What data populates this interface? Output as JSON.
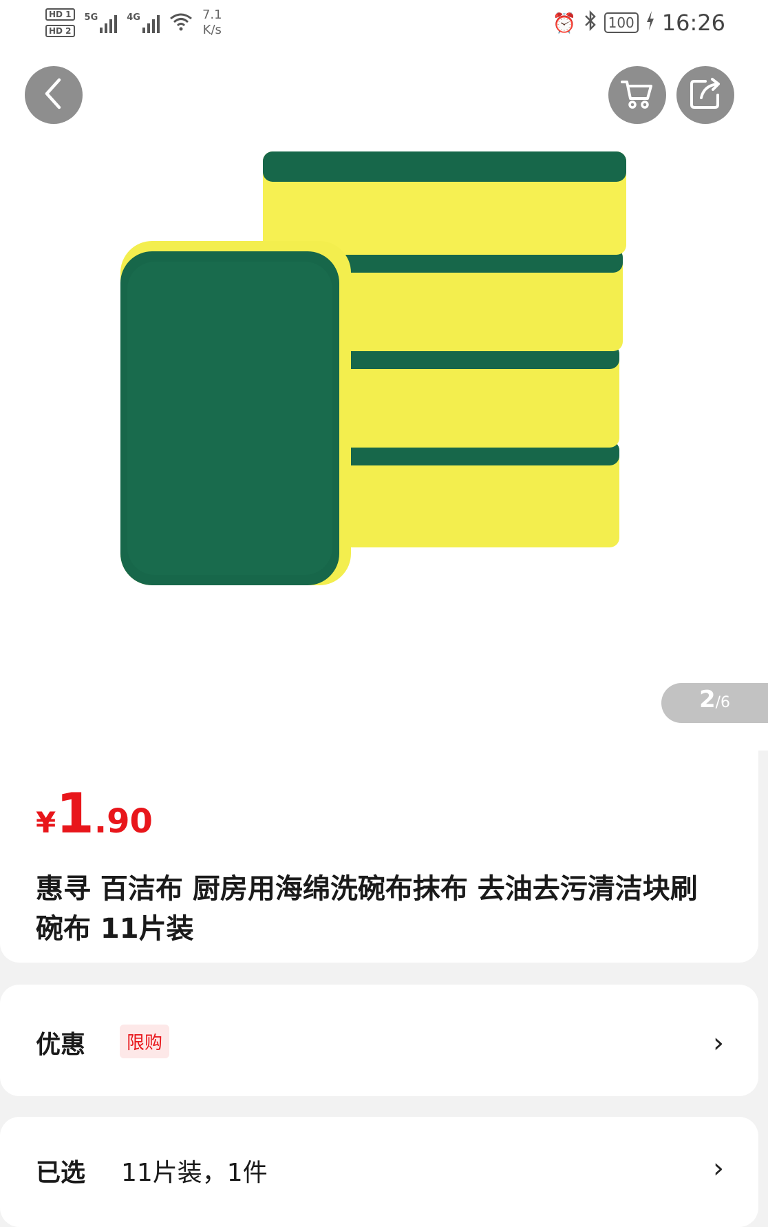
{
  "status_bar": {
    "hd1": "HD 1",
    "hd2": "HD 2",
    "net1": "5G",
    "net2": "4G",
    "speed_value": "7.1",
    "speed_unit": "K/s",
    "battery": "100",
    "time": "16:26"
  },
  "gallery": {
    "current": "2",
    "total": "/6"
  },
  "product": {
    "currency": "¥",
    "price_int": "1",
    "price_dec": ".90",
    "title": "惠寻 百洁布 厨房用海绵洗碗布抹布 去油去污清洁块刷碗布 11片装"
  },
  "promo": {
    "label": "优惠",
    "tag": "限购"
  },
  "selection": {
    "label": "已选",
    "value": "11片装，1件"
  },
  "colors": {
    "accent": "#e8161b",
    "sponge_green": "#17674a",
    "sponge_yellow": "#f3ee4e"
  }
}
